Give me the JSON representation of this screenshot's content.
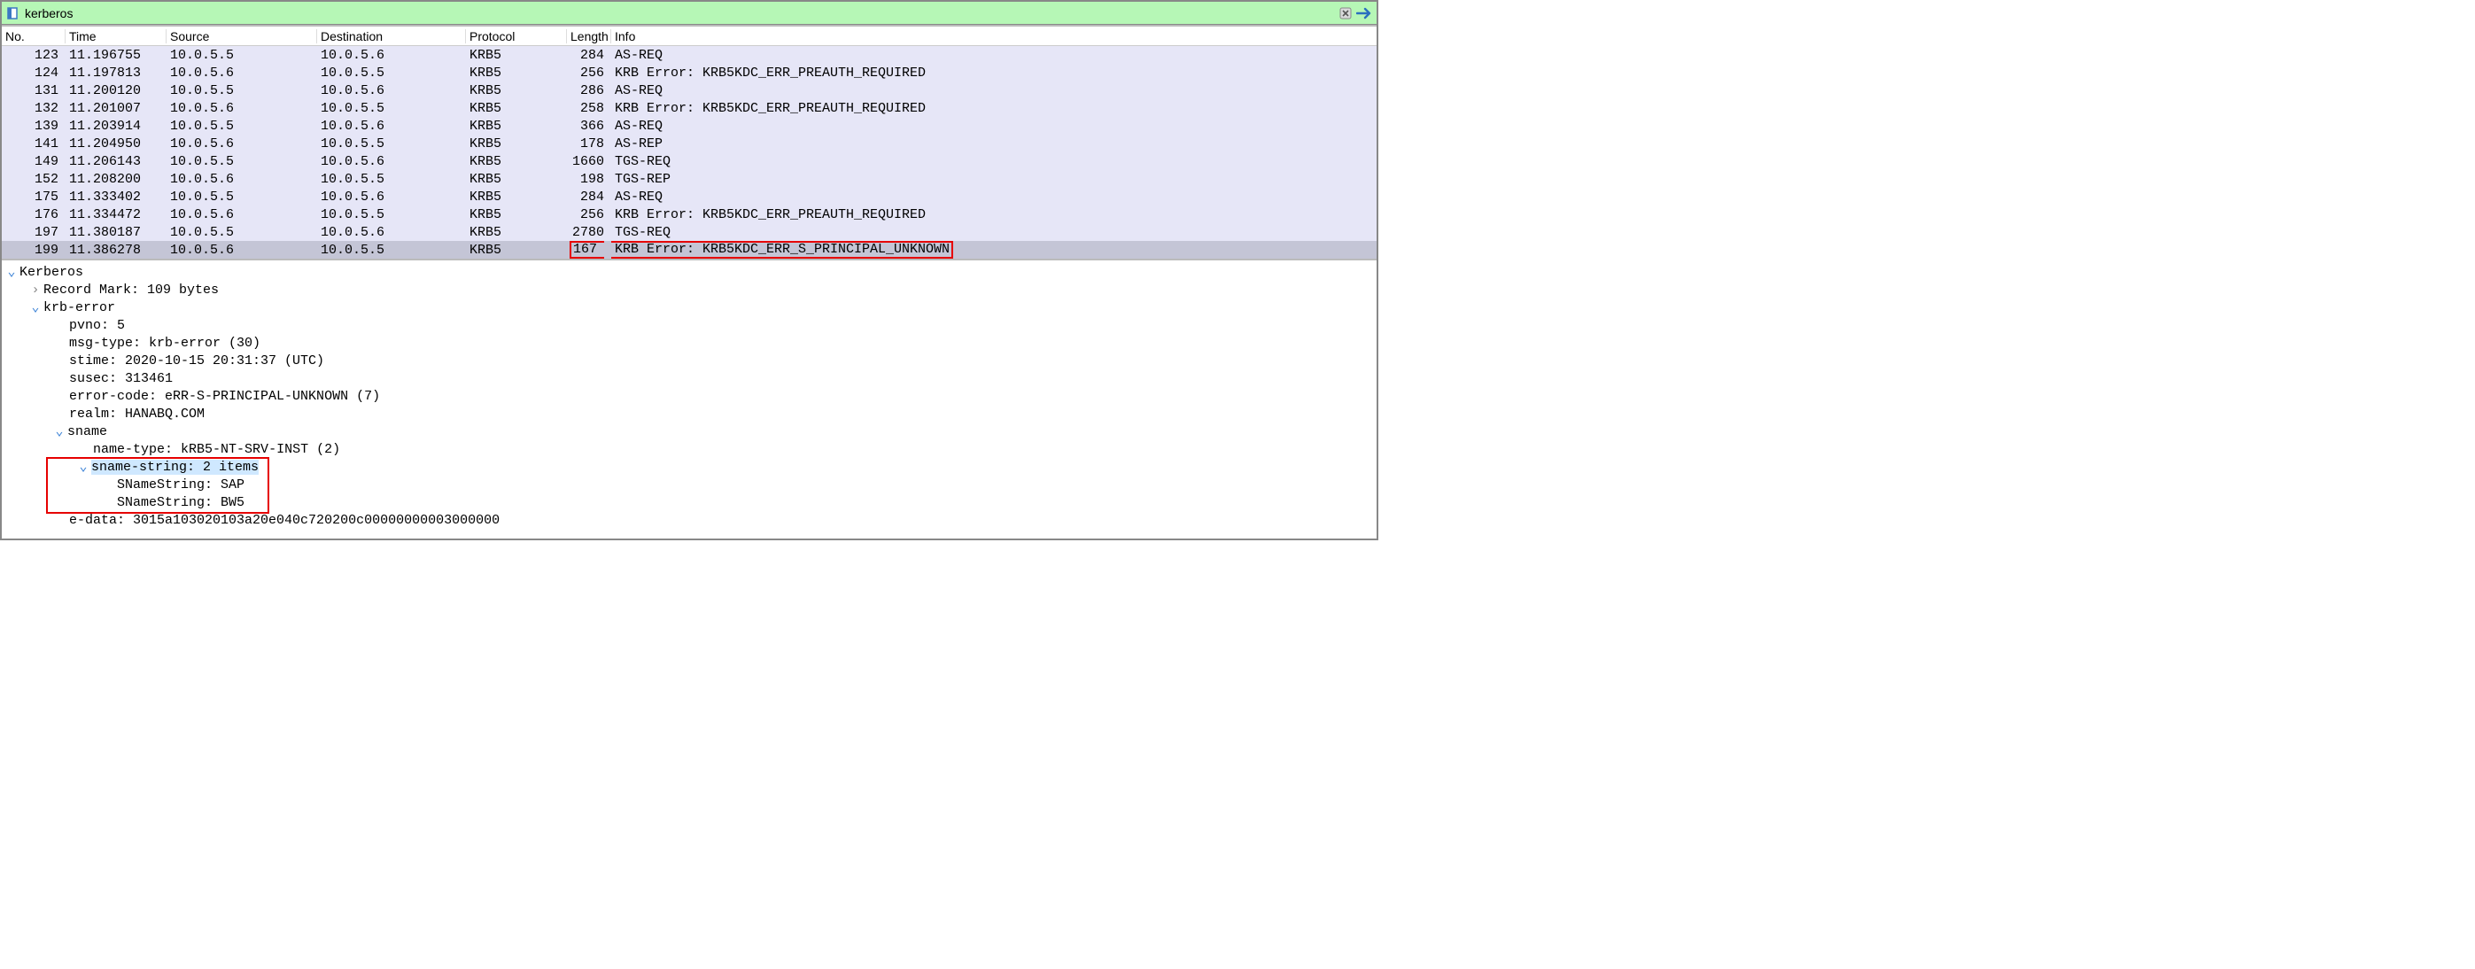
{
  "filter": {
    "text": "kerberos"
  },
  "columns": [
    "No.",
    "Time",
    "Source",
    "Destination",
    "Protocol",
    "Length",
    "Info"
  ],
  "packets": [
    {
      "no": "123",
      "time": "11.196755",
      "src": "10.0.5.5",
      "dst": "10.0.5.6",
      "proto": "KRB5",
      "len": "284",
      "info": "AS-REQ",
      "sel": false
    },
    {
      "no": "124",
      "time": "11.197813",
      "src": "10.0.5.6",
      "dst": "10.0.5.5",
      "proto": "KRB5",
      "len": "256",
      "info": "KRB Error: KRB5KDC_ERR_PREAUTH_REQUIRED",
      "sel": false
    },
    {
      "no": "131",
      "time": "11.200120",
      "src": "10.0.5.5",
      "dst": "10.0.5.6",
      "proto": "KRB5",
      "len": "286",
      "info": "AS-REQ",
      "sel": false
    },
    {
      "no": "132",
      "time": "11.201007",
      "src": "10.0.5.6",
      "dst": "10.0.5.5",
      "proto": "KRB5",
      "len": "258",
      "info": "KRB Error: KRB5KDC_ERR_PREAUTH_REQUIRED",
      "sel": false
    },
    {
      "no": "139",
      "time": "11.203914",
      "src": "10.0.5.5",
      "dst": "10.0.5.6",
      "proto": "KRB5",
      "len": "366",
      "info": "AS-REQ",
      "sel": false
    },
    {
      "no": "141",
      "time": "11.204950",
      "src": "10.0.5.6",
      "dst": "10.0.5.5",
      "proto": "KRB5",
      "len": "178",
      "info": "AS-REP",
      "sel": false
    },
    {
      "no": "149",
      "time": "11.206143",
      "src": "10.0.5.5",
      "dst": "10.0.5.6",
      "proto": "KRB5",
      "len": "1660",
      "info": "TGS-REQ",
      "sel": false
    },
    {
      "no": "152",
      "time": "11.208200",
      "src": "10.0.5.6",
      "dst": "10.0.5.5",
      "proto": "KRB5",
      "len": "198",
      "info": "TGS-REP",
      "sel": false
    },
    {
      "no": "175",
      "time": "11.333402",
      "src": "10.0.5.5",
      "dst": "10.0.5.6",
      "proto": "KRB5",
      "len": "284",
      "info": "AS-REQ",
      "sel": false
    },
    {
      "no": "176",
      "time": "11.334472",
      "src": "10.0.5.6",
      "dst": "10.0.5.5",
      "proto": "KRB5",
      "len": "256",
      "info": "KRB Error: KRB5KDC_ERR_PREAUTH_REQUIRED",
      "sel": false
    },
    {
      "no": "197",
      "time": "11.380187",
      "src": "10.0.5.5",
      "dst": "10.0.5.6",
      "proto": "KRB5",
      "len": "2780",
      "info": "TGS-REQ",
      "sel": false
    },
    {
      "no": "199",
      "time": "11.386278",
      "src": "10.0.5.6",
      "dst": "10.0.5.5",
      "proto": "KRB5",
      "len": "167",
      "info": "KRB Error: KRB5KDC_ERR_S_PRINCIPAL_UNKNOWN",
      "sel": true,
      "boxinfo": true
    }
  ],
  "details": {
    "root": "Kerberos",
    "recordmark": "Record Mark: 109 bytes",
    "krberror": "krb-error",
    "pvno": "pvno: 5",
    "msgtype": "msg-type: krb-error (30)",
    "stime": "stime: 2020-10-15 20:31:37 (UTC)",
    "susec": "susec: 313461",
    "errorcode": "error-code: eRR-S-PRINCIPAL-UNKNOWN (7)",
    "realm": "realm: HANABQ.COM",
    "sname": "sname",
    "nametype": "name-type: kRB5-NT-SRV-INST (2)",
    "snamestring": "sname-string: 2 items",
    "sns1": "SNameString: SAP",
    "sns2": "SNameString: BW5",
    "edata": "e-data: 3015a103020103a20e040c720200c00000000003000000"
  },
  "icons": {
    "bookmark": "◧",
    "clear": "✕",
    "arrow": "➡"
  }
}
